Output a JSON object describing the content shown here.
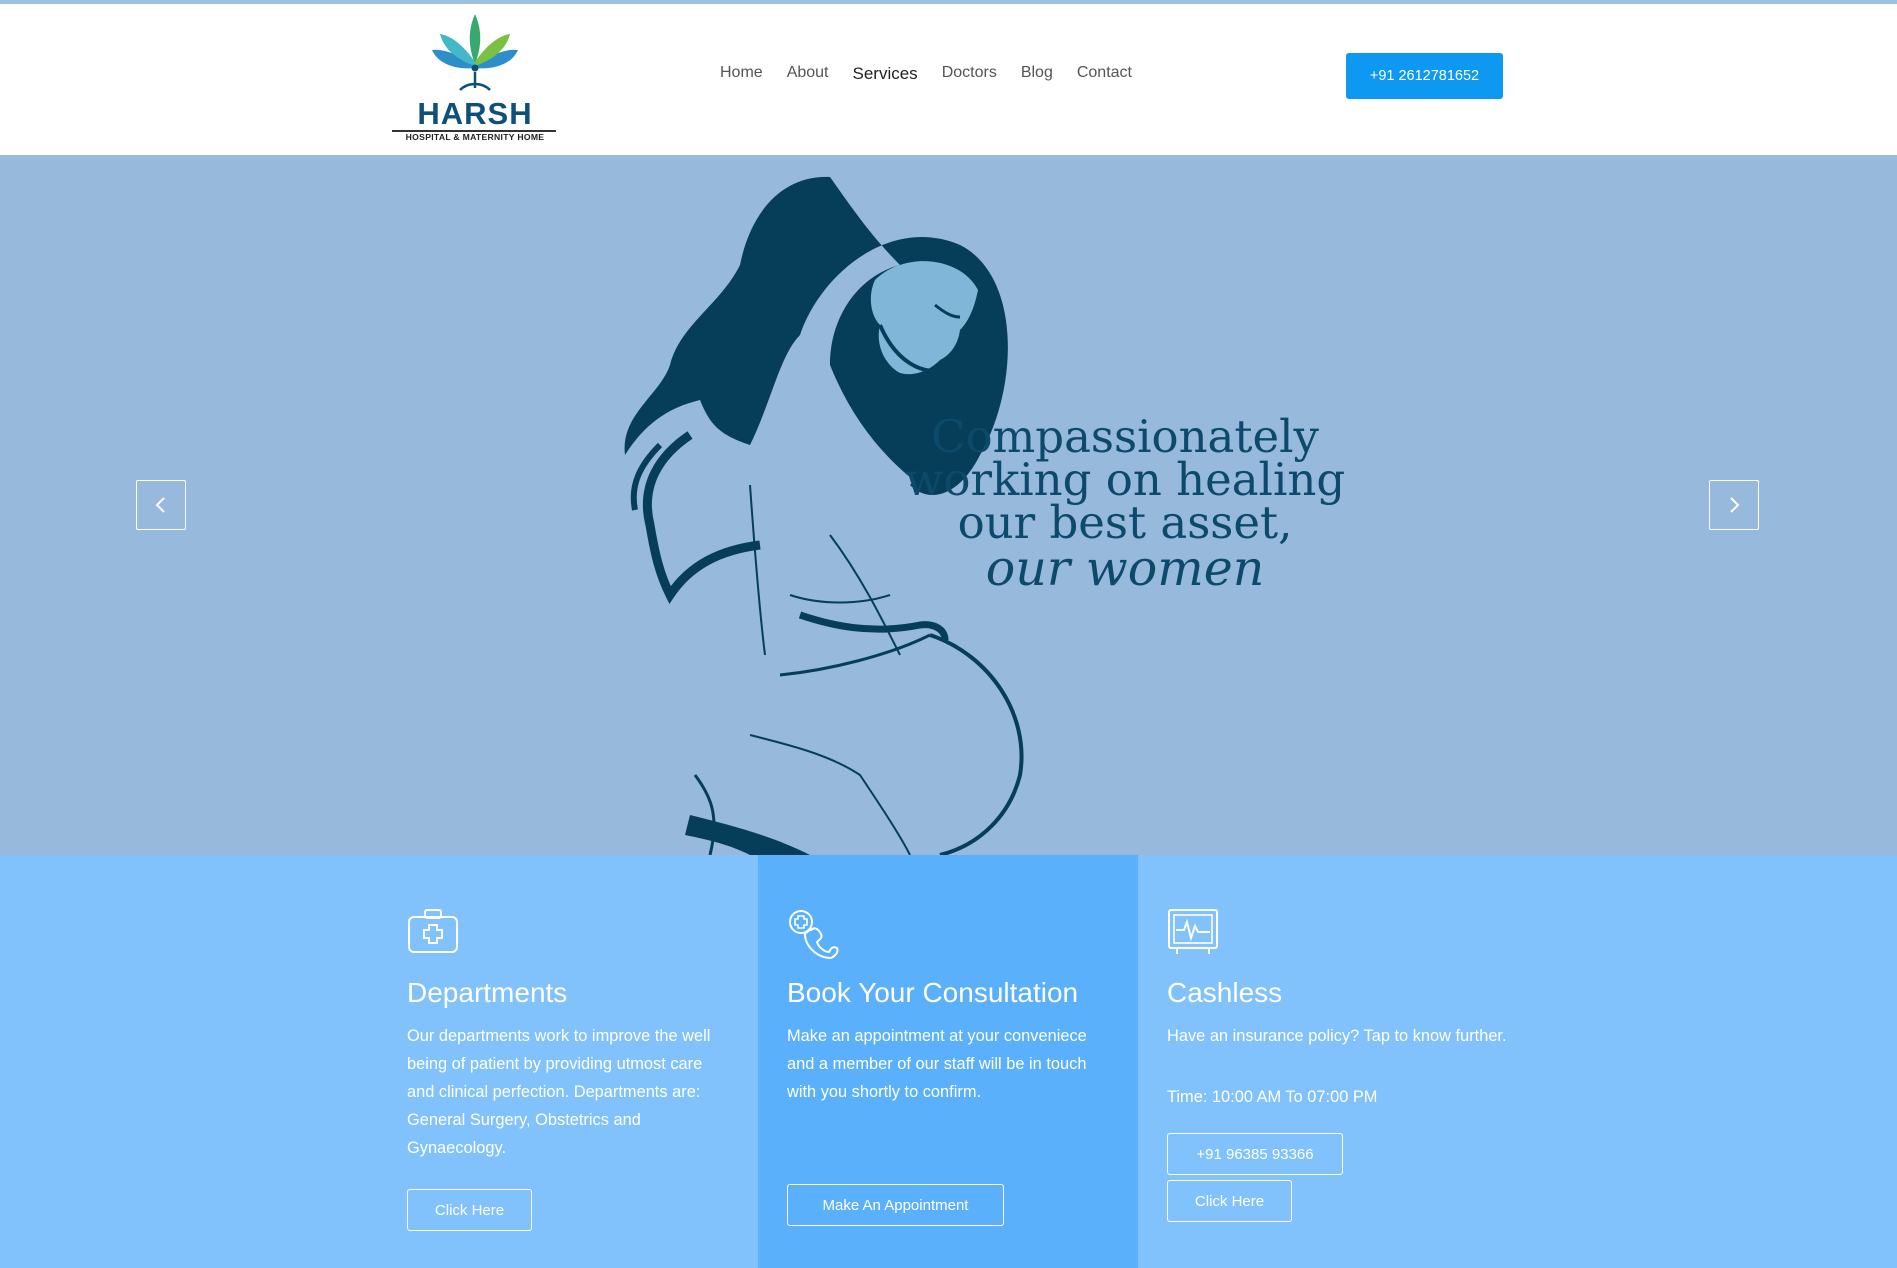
{
  "brand": {
    "name": "HARSH",
    "subtitle": "HOSPITAL & MATERNITY HOME",
    "colors": {
      "primary": "#0d99f2",
      "navy": "#0e4f7b",
      "hero_bg": "#97b9db",
      "features_bg": "#82c2fc",
      "features_mid_bg": "#5ab0fb"
    }
  },
  "nav": {
    "items": [
      {
        "label": "Home",
        "active": false
      },
      {
        "label": "About",
        "active": false
      },
      {
        "label": "Services",
        "active": true
      },
      {
        "label": "Doctors",
        "active": false
      },
      {
        "label": "Blog",
        "active": false
      },
      {
        "label": "Contact",
        "active": false
      }
    ],
    "phone_button": "+91 2612781652"
  },
  "hero": {
    "lines": [
      "Compassionately",
      "working on healing",
      "our best asset,"
    ],
    "emphasis": "our women",
    "prev_icon": "chevron-left-icon",
    "next_icon": "chevron-right-icon"
  },
  "features": [
    {
      "icon": "medical-kit-icon",
      "title": "Departments",
      "text": "Our departments work to improve the well being of patient by providing utmost care and clinical perfection. Departments are: General Surgery, Obstetrics and Gynaecology.",
      "button": "Click Here"
    },
    {
      "icon": "phone-medical-icon",
      "title": "Book Your Consultation",
      "text": "Make an appointment at your conveniece and a member of our staff will be in touch with you shortly to confirm.",
      "button": "Make An Appointment"
    },
    {
      "icon": "heart-monitor-icon",
      "title": "Cashless",
      "text": "Have an insurance policy? Tap to know further.",
      "time": "Time: 10:00 AM To 07:00 PM",
      "phone_button": "+91 96385 93366",
      "button": "Click Here"
    }
  ]
}
